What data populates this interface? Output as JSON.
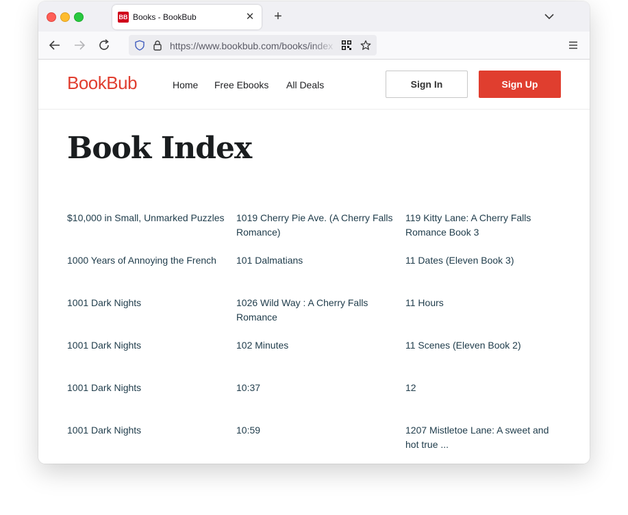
{
  "browser": {
    "tab": {
      "favicon_text": "BB",
      "title": "Books - BookBub",
      "close_glyph": "✕"
    },
    "new_tab_glyph": "+",
    "url": "https://www.bookbub.com/books/index"
  },
  "site": {
    "logo": "BookBub",
    "brand_color": "#e03e2f",
    "nav": [
      {
        "label": "Home"
      },
      {
        "label": "Free Ebooks"
      },
      {
        "label": "All Deals"
      }
    ],
    "sign_in": "Sign In",
    "sign_up": "Sign Up"
  },
  "page": {
    "title": "Book Index",
    "columns": [
      [
        "$10,000 in Small, Unmarked Puzzles",
        "1000 Years of Annoying the French",
        "1001 Dark Nights",
        "1001 Dark Nights",
        "1001 Dark Nights",
        "1001 Dark Nights"
      ],
      [
        "1019 Cherry Pie Ave. (A Cherry Falls Romance)",
        "101 Dalmatians",
        "1026 Wild Way : A Cherry Falls Romance",
        "102 Minutes",
        "10:37",
        "10:59"
      ],
      [
        "119 Kitty Lane: A Cherry Falls Romance Book 3",
        "11 Dates (Eleven Book 3)",
        "11 Hours",
        "11 Scenes (Eleven Book 2)",
        "12",
        "1207 Mistletoe Lane: A sweet and hot true ..."
      ]
    ]
  }
}
